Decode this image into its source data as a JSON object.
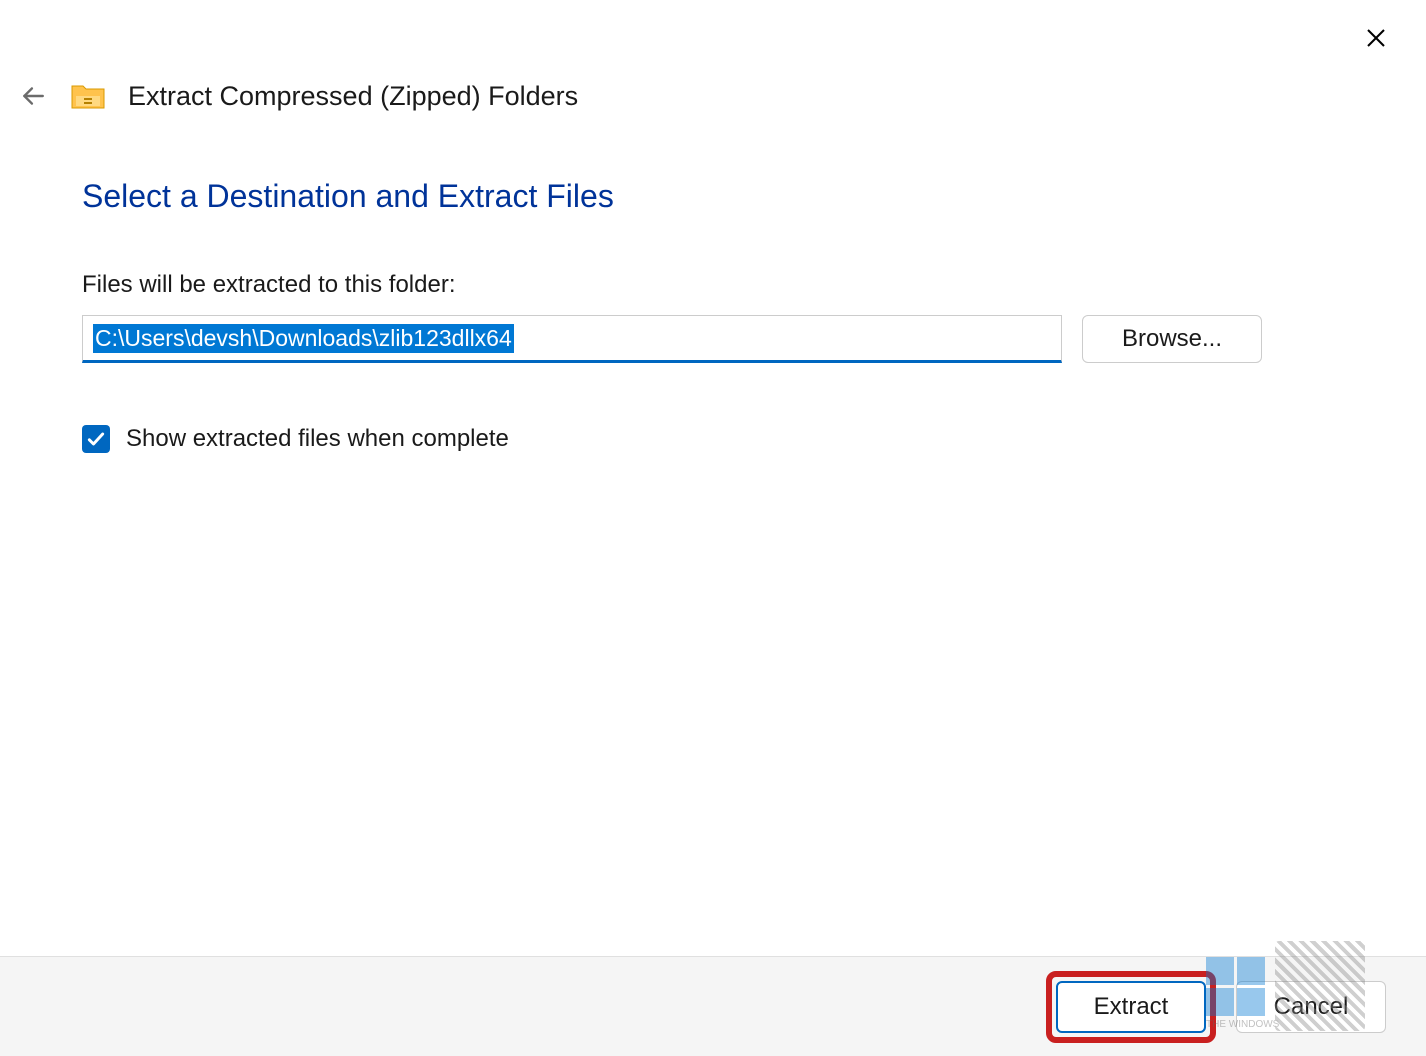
{
  "header": {
    "title": "Extract Compressed (Zipped) Folders"
  },
  "main": {
    "heading": "Select a Destination and Extract Files",
    "field_label": "Files will be extracted to this folder:",
    "path_value": "C:\\Users\\devsh\\Downloads\\zlib123dllx64",
    "browse_label": "Browse...",
    "checkbox_label": "Show extracted files when complete",
    "checkbox_checked": true
  },
  "footer": {
    "extract_label": "Extract",
    "cancel_label": "Cancel"
  },
  "watermark": {
    "text": "THE WINDOWS"
  }
}
